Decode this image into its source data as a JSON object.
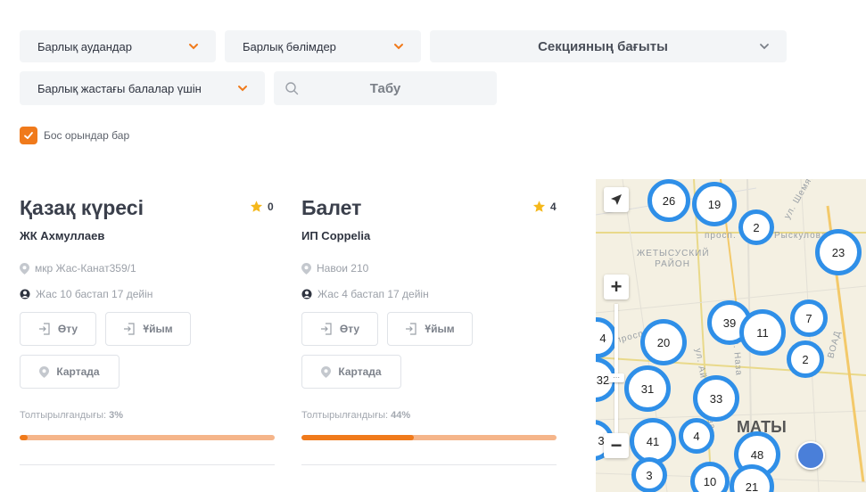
{
  "filters": {
    "district": "Барлық аудандар",
    "department": "Барлық бөлімдер",
    "direction": "Секцияның бағыты",
    "age": "Барлық жастағы балалар үшін",
    "search_placeholder": "Табу",
    "vacancies_label": "Бос орындар бар",
    "vacancies_checked": true
  },
  "cards": [
    {
      "title": "Қазақ күресі",
      "rating": "0",
      "org": "ЖК Ахмуллаев",
      "address": "мкр Жас-Канат359/1",
      "age": "Жас 10 бастап 17 дейін",
      "apply_label": "Өту",
      "org_label": "Ұйым",
      "map_label": "Картада",
      "fill_label": "Толтырылғандығы:",
      "fill_value": "3%",
      "fill_fraction": 0.03
    },
    {
      "title": "Балет",
      "rating": "4",
      "org": "ИП Coppelia",
      "address": "Навои 210",
      "age": "Жас 4 бастап 17 дейін",
      "apply_label": "Өту",
      "org_label": "Ұйым",
      "map_label": "Картада",
      "fill_label": "Толтырылғандығы:",
      "fill_value": "44%",
      "fill_fraction": 0.44
    }
  ],
  "map": {
    "district_label": "ЖЕТЫСУСКИЙ РАЙОН",
    "city_label": "МАТЫ",
    "street_labels": [
      "просп.",
      "ул. Шемяк",
      "Рыскулова",
      "просп. Р",
      "п. Наза",
      "ВОАД",
      "ул. Айтурсынова"
    ],
    "clusters": [
      "26",
      "19",
      "2",
      "23",
      "39",
      "11",
      "7",
      "4",
      "20",
      "2",
      "32",
      "31",
      "33",
      "3",
      "41",
      "4",
      "48",
      "3",
      "10",
      "21"
    ],
    "zoom_in": "+",
    "zoom_out": "−",
    "accent": "#2f8fe8"
  },
  "colors": {
    "accent": "#f07a1b",
    "accent_light": "#f5b58a"
  }
}
